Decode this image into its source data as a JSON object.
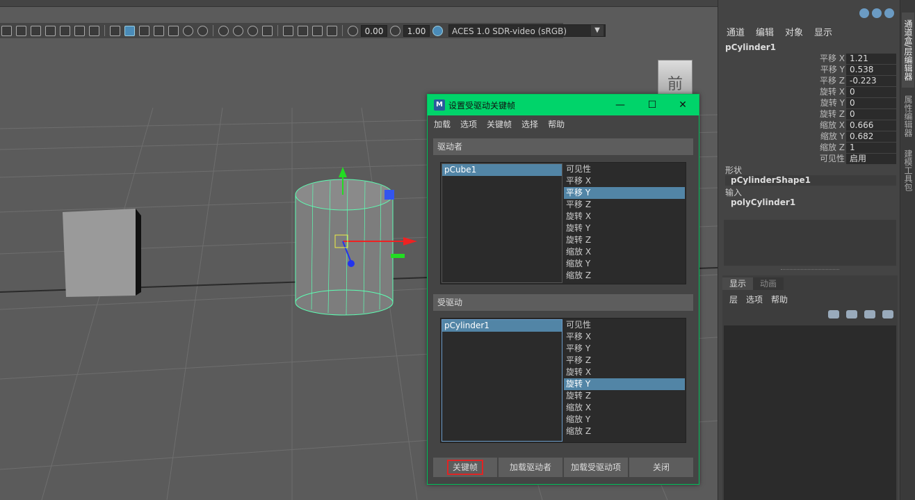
{
  "viewport_toolbar": {
    "field1": "0.00",
    "field2": "1.00",
    "color_space": "ACES 1.0 SDR-video (sRGB)"
  },
  "viewcube": {
    "face": "前"
  },
  "channel_box": {
    "menu": [
      "通道",
      "编辑",
      "对象",
      "显示"
    ],
    "object_name": "pCylinder1",
    "attributes": [
      {
        "label": "平移 X",
        "value": "1.21"
      },
      {
        "label": "平移 Y",
        "value": "0.538"
      },
      {
        "label": "平移 Z",
        "value": "-0.223"
      },
      {
        "label": "旋转 X",
        "value": "0"
      },
      {
        "label": "旋转 Y",
        "value": "0"
      },
      {
        "label": "旋转 Z",
        "value": "0"
      },
      {
        "label": "缩放 X",
        "value": "0.666"
      },
      {
        "label": "缩放 Y",
        "value": "0.682"
      },
      {
        "label": "缩放 Z",
        "value": "1"
      },
      {
        "label": "可见性",
        "value": "启用"
      }
    ],
    "shapes_label": "形状",
    "shape_node": "pCylinderShape1",
    "inputs_label": "输入",
    "input_node": "polyCylinder1"
  },
  "layer_editor": {
    "tabs": [
      "显示",
      "动画"
    ],
    "menu": [
      "层",
      "选项",
      "帮助"
    ]
  },
  "side_tabs": [
    "通道盒/层编辑器",
    "属性编辑器",
    "建模工具包"
  ],
  "dialog": {
    "app_icon": "M",
    "title": "设置受驱动关键帧",
    "win_minimize": "—",
    "win_maximize": "☐",
    "win_close": "✕",
    "menu": [
      "加载",
      "选项",
      "关键帧",
      "选择",
      "帮助"
    ],
    "driver_label": "驱动者",
    "driver_object": "pCube1",
    "driver_attributes": [
      "可见性",
      "平移 X",
      "平移 Y",
      "平移 Z",
      "旋转 X",
      "旋转 Y",
      "旋转 Z",
      "缩放 X",
      "缩放 Y",
      "缩放 Z"
    ],
    "driven_label": "受驱动",
    "driven_object": "pCylinder1",
    "driven_attributes": [
      "可见性",
      "平移 X",
      "平移 Y",
      "平移 Z",
      "旋转 X",
      "旋转 Y",
      "旋转 Z",
      "缩放 X",
      "缩放 Y",
      "缩放 Z"
    ],
    "buttons": [
      "关键帧",
      "加载驱动者",
      "加载受驱动项",
      "关闭"
    ]
  }
}
